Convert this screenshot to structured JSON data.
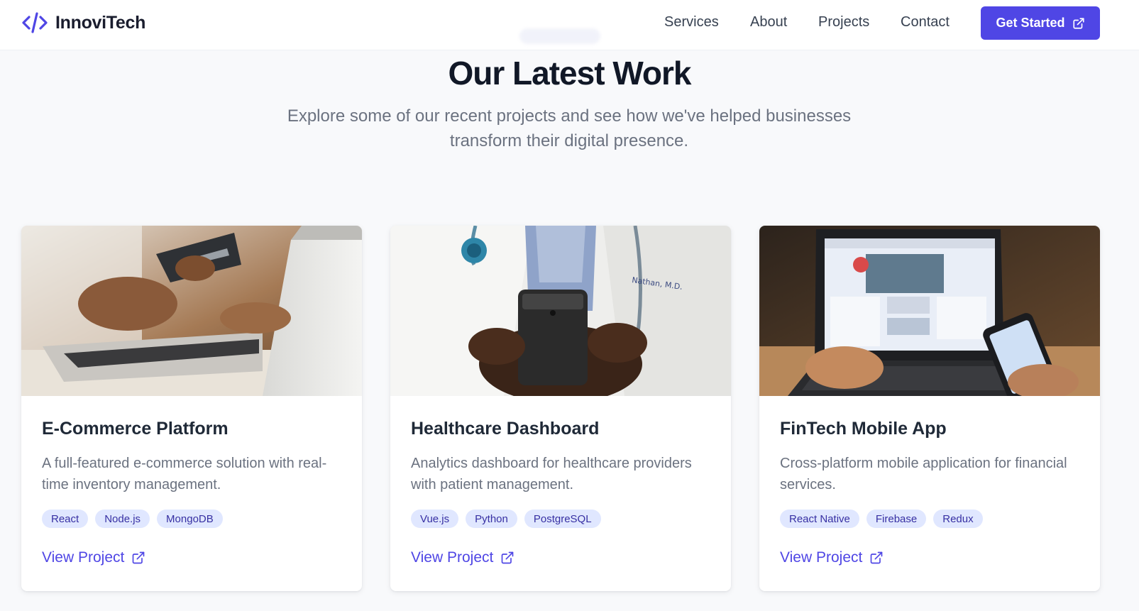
{
  "header": {
    "brand": "InnoviTech",
    "nav": [
      {
        "label": "Services"
      },
      {
        "label": "About"
      },
      {
        "label": "Projects"
      },
      {
        "label": "Contact"
      }
    ],
    "cta_label": "Get Started"
  },
  "hero": {
    "title": "Our Latest Work",
    "subtitle": "Explore some of our recent projects and see how we've helped businesses transform their digital presence."
  },
  "projects": [
    {
      "title": "E-Commerce Platform",
      "description": "A full-featured e-commerce solution with real-time inventory management.",
      "tags": [
        "React",
        "Node.js",
        "MongoDB"
      ],
      "link_label": "View Project",
      "image": "hands-laptop-credit-card"
    },
    {
      "title": "Healthcare Dashboard",
      "description": "Analytics dashboard for healthcare providers with patient management.",
      "tags": [
        "Vue.js",
        "Python",
        "PostgreSQL"
      ],
      "link_label": "View Project",
      "image": "doctor-holding-phone"
    },
    {
      "title": "FinTech Mobile App",
      "description": "Cross-platform mobile application for financial services.",
      "tags": [
        "React Native",
        "Firebase",
        "Redux"
      ],
      "link_label": "View Project",
      "image": "laptop-and-smartphone"
    }
  ],
  "colors": {
    "accent": "#4f46e5",
    "tag_bg": "#e0e7ff",
    "tag_text": "#3730a3",
    "page_bg": "#f8f9fb"
  },
  "icons": {
    "logo": "code-brackets-icon",
    "external": "external-link-icon"
  }
}
